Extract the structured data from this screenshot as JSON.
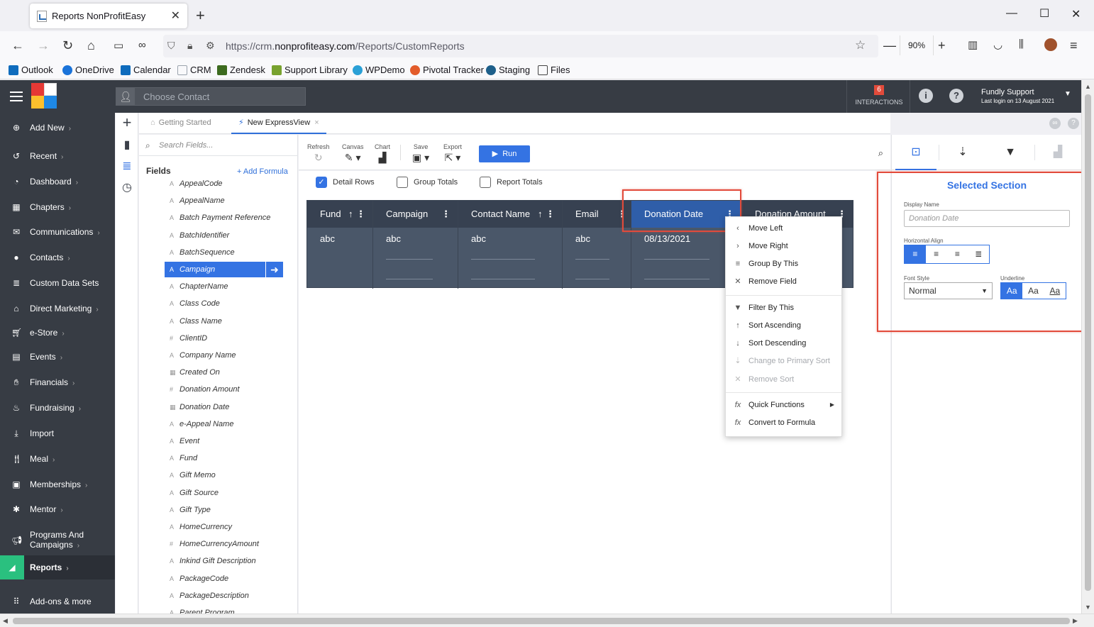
{
  "browser": {
    "tab_title": "Reports NonProfitEasy",
    "url_prefix": "https://crm.",
    "url_domain": "nonprofiteasy.com",
    "url_path": "/Reports/CustomReports",
    "zoom": "90%",
    "bookmarks": [
      {
        "label": "Outlook",
        "icon": "outlook-icon",
        "color": "#0f6cbd"
      },
      {
        "label": "OneDrive",
        "icon": "onedrive-icon",
        "color": "#1a73d9"
      },
      {
        "label": "Calendar",
        "icon": "outlook-calendar-icon",
        "color": "#0f6cbd"
      },
      {
        "label": "CRM",
        "icon": "page-icon",
        "color": "#9aa3ad"
      },
      {
        "label": "Zendesk",
        "icon": "zendesk-icon",
        "color": "#3d6b1f"
      },
      {
        "label": "Support Library",
        "icon": "support-icon",
        "color": "#78a22f"
      },
      {
        "label": "WPDemo",
        "icon": "wordpress-icon",
        "color": "#2aa0d6"
      },
      {
        "label": "Pivotal Tracker",
        "icon": "pivotal-icon",
        "color": "#e35c2b"
      },
      {
        "label": "Staging",
        "icon": "staging-icon",
        "color": "#1d5f8a"
      },
      {
        "label": "Files",
        "icon": "folder-icon",
        "color": "#444444"
      }
    ]
  },
  "header": {
    "contact_placeholder": "Choose Contact",
    "interactions_count": "6",
    "interactions_label": "INTERACTIONS",
    "user_name": "Fundly Support",
    "last_login": "Last login on 13 August 2021"
  },
  "sidebar": {
    "items": [
      {
        "label": "Add New",
        "icon": "plus-circle-icon",
        "chevron": true
      },
      {
        "label": "Recent",
        "icon": "history-icon",
        "chevron": true
      },
      {
        "label": "Dashboard",
        "icon": "dashboard-icon",
        "chevron": true
      },
      {
        "label": "Chapters",
        "icon": "grid-icon",
        "chevron": true
      },
      {
        "label": "Communications",
        "icon": "envelope-icon",
        "chevron": true
      },
      {
        "label": "Contacts",
        "icon": "person-icon",
        "chevron": true
      },
      {
        "label": "Custom Data Sets",
        "icon": "database-icon",
        "chevron": false
      },
      {
        "label": "Direct Marketing",
        "icon": "bank-icon",
        "chevron": true
      },
      {
        "label": "e-Store",
        "icon": "cart-icon",
        "chevron": true
      },
      {
        "label": "Events",
        "icon": "calendar-icon",
        "chevron": true
      },
      {
        "label": "Financials",
        "icon": "handshake-icon",
        "chevron": true
      },
      {
        "label": "Fundraising",
        "icon": "fundraising-icon",
        "chevron": true
      },
      {
        "label": "Import",
        "icon": "download-icon",
        "chevron": false
      },
      {
        "label": "Meal",
        "icon": "utensils-icon",
        "chevron": true
      },
      {
        "label": "Memberships",
        "icon": "id-card-icon",
        "chevron": true
      },
      {
        "label": "Mentor",
        "icon": "mentor-icon",
        "chevron": true
      },
      {
        "label": "Programs And",
        "label2": "Campaigns",
        "icon": "megaphone-icon",
        "chevron": true
      },
      {
        "label": "Reports",
        "icon": "chart-icon",
        "chevron": true,
        "active": true
      },
      {
        "label": "Add-ons & more",
        "icon": "apps-grid-icon",
        "chevron": false
      }
    ]
  },
  "tabs": [
    {
      "label": "Getting Started",
      "icon": "home-icon"
    },
    {
      "label": "New ExpressView",
      "icon": "bolt-icon",
      "active": true
    }
  ],
  "fields_panel": {
    "search_placeholder": "Search Fields...",
    "heading": "Fields",
    "add_formula": "+ Add Formula",
    "fields": [
      {
        "label": "AppealCode",
        "type": "text"
      },
      {
        "label": "AppealName",
        "type": "text"
      },
      {
        "label": "Batch Payment Reference",
        "type": "text"
      },
      {
        "label": "BatchIdentifier",
        "type": "text"
      },
      {
        "label": "BatchSequence",
        "type": "text"
      },
      {
        "label": "Campaign",
        "type": "text",
        "selected": true
      },
      {
        "label": "ChapterName",
        "type": "text"
      },
      {
        "label": "Class Code",
        "type": "text"
      },
      {
        "label": "Class Name",
        "type": "text"
      },
      {
        "label": "ClientID",
        "type": "number"
      },
      {
        "label": "Company Name",
        "type": "text"
      },
      {
        "label": "Created On",
        "type": "date"
      },
      {
        "label": "Donation Amount",
        "type": "number"
      },
      {
        "label": "Donation Date",
        "type": "date"
      },
      {
        "label": "e-Appeal Name",
        "type": "text"
      },
      {
        "label": "Event",
        "type": "text"
      },
      {
        "label": "Fund",
        "type": "text"
      },
      {
        "label": "Gift Memo",
        "type": "text"
      },
      {
        "label": "Gift Source",
        "type": "text"
      },
      {
        "label": "Gift Type",
        "type": "text"
      },
      {
        "label": "HomeCurrency",
        "type": "text"
      },
      {
        "label": "HomeCurrencyAmount",
        "type": "number"
      },
      {
        "label": "Inkind Gift Description",
        "type": "text"
      },
      {
        "label": "PackageCode",
        "type": "text"
      },
      {
        "label": "PackageDescription",
        "type": "text"
      },
      {
        "label": "Parent Program",
        "type": "text"
      }
    ]
  },
  "toolbar": {
    "refresh": "Refresh",
    "canvas": "Canvas",
    "chart": "Chart",
    "save": "Save",
    "export": "Export",
    "run": "Run"
  },
  "options": {
    "detail_rows": "Detail Rows",
    "detail_rows_checked": true,
    "group_totals": "Group Totals",
    "group_totals_checked": false,
    "report_totals": "Report Totals",
    "report_totals_checked": false
  },
  "grid": {
    "columns": [
      {
        "header": "Fund",
        "value": "abc",
        "sort": true
      },
      {
        "header": "Campaign",
        "value": "abc",
        "sort": false
      },
      {
        "header": "Contact Name",
        "value": "abc",
        "sort": true
      },
      {
        "header": "Email",
        "value": "abc",
        "sort": false
      },
      {
        "header": "Donation Date",
        "value": "08/13/2021",
        "sort": false,
        "selected": true
      },
      {
        "header": "Donation Amount",
        "value": "",
        "sort": false
      }
    ]
  },
  "context_menu": {
    "items": [
      {
        "label": "Move Left",
        "icon": "chevron-left-icon"
      },
      {
        "label": "Move Right",
        "icon": "chevron-right-icon"
      },
      {
        "label": "Group By This",
        "icon": "group-icon"
      },
      {
        "label": "Remove Field",
        "icon": "close-icon"
      },
      {
        "label": "Filter By This",
        "icon": "filter-icon"
      },
      {
        "label": "Sort Ascending",
        "icon": "arrow-up-icon"
      },
      {
        "label": "Sort Descending",
        "icon": "arrow-down-icon"
      },
      {
        "label": "Change to Primary Sort",
        "icon": "primary-sort-icon",
        "disabled": true
      },
      {
        "label": "Remove Sort",
        "icon": "close-icon",
        "disabled": true
      },
      {
        "label": "Quick Functions",
        "icon": "fx-icon",
        "submenu": true
      },
      {
        "label": "Convert to Formula",
        "icon": "fx-icon"
      }
    ]
  },
  "properties": {
    "title": "Selected Section",
    "display_name_label": "Display Name",
    "display_name_value": "Donation Date",
    "horizontal_align_label": "Horizontal Align",
    "font_style_label": "Font Style",
    "font_style_value": "Normal",
    "underline_label": "Underline",
    "underline_options": [
      "Aa",
      "Aa",
      "Aa"
    ]
  },
  "colors": {
    "accent": "#3473e3",
    "sidebar_bg": "#373c44",
    "highlight": "#e24b3b",
    "reports_active": "#2ac07f"
  }
}
